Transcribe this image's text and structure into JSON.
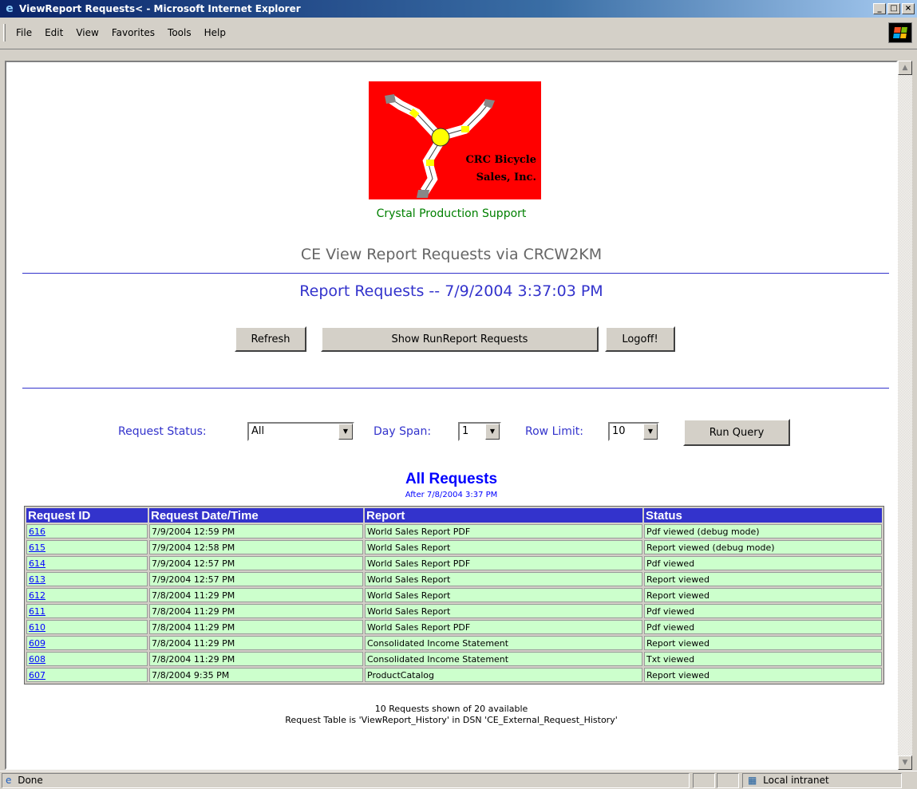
{
  "window": {
    "title": "ViewReport Requests< - Microsoft Internet Explorer",
    "minimize": "_",
    "maximize": "□",
    "close": "×"
  },
  "menu": {
    "items": [
      {
        "label": "File"
      },
      {
        "label": "Edit"
      },
      {
        "label": "View"
      },
      {
        "label": "Favorites"
      },
      {
        "label": "Tools"
      },
      {
        "label": "Help"
      }
    ]
  },
  "page": {
    "logo_line1": "CRC Bicycle",
    "logo_line2": "Sales, Inc.",
    "subtitle": "Crystal Production Support",
    "ce_title": "CE View Report Requests via CRCW2KM",
    "requests_title": "Report Requests -- 7/9/2004 3:37:03 PM",
    "buttons": {
      "refresh": "Refresh",
      "show_run": "Show RunReport Requests",
      "logoff": "Logoff!",
      "run_query": "Run Query"
    },
    "filters": {
      "status_label": "Request Status:",
      "status_value": "All",
      "dayspan_label": "Day Span:",
      "dayspan_value": "1",
      "rowlimit_label": "Row Limit:",
      "rowlimit_value": "10"
    },
    "all_title": "All Requests",
    "after_text": "After 7/8/2004 3:37 PM",
    "table": {
      "headers": [
        "Request ID",
        "Request Date/Time",
        "Report",
        "Status"
      ],
      "rows": [
        {
          "id": "616",
          "datetime": "7/9/2004 12:59 PM",
          "report": "World Sales Report PDF",
          "status": "Pdf viewed (debug mode)"
        },
        {
          "id": "615",
          "datetime": "7/9/2004 12:58 PM",
          "report": "World Sales Report",
          "status": "Report viewed (debug mode)"
        },
        {
          "id": "614",
          "datetime": "7/9/2004 12:57 PM",
          "report": "World Sales Report PDF",
          "status": "Pdf viewed"
        },
        {
          "id": "613",
          "datetime": "7/9/2004 12:57 PM",
          "report": "World Sales Report",
          "status": "Report viewed"
        },
        {
          "id": "612",
          "datetime": "7/8/2004 11:29 PM",
          "report": "World Sales Report",
          "status": "Report viewed"
        },
        {
          "id": "611",
          "datetime": "7/8/2004 11:29 PM",
          "report": "World Sales Report",
          "status": "Pdf viewed"
        },
        {
          "id": "610",
          "datetime": "7/8/2004 11:29 PM",
          "report": "World Sales Report PDF",
          "status": "Pdf viewed"
        },
        {
          "id": "609",
          "datetime": "7/8/2004 11:29 PM",
          "report": "Consolidated Income Statement",
          "status": "Report viewed"
        },
        {
          "id": "608",
          "datetime": "7/8/2004 11:29 PM",
          "report": "Consolidated Income Statement",
          "status": "Txt viewed"
        },
        {
          "id": "607",
          "datetime": "7/8/2004 9:35 PM",
          "report": "ProductCatalog",
          "status": "Report viewed"
        }
      ]
    },
    "footer_count": "10 Requests shown of 20 available",
    "footer_table": "Request Table is 'ViewReport_History' in DSN 'CE_External_Request_History'"
  },
  "statusbar": {
    "done": "Done",
    "zone": "Local intranet"
  },
  "colors": {
    "header_bg": "#3333cc",
    "row_bg": "#ccffcc",
    "logo_bg": "#ff0000",
    "subtitle": "#008000"
  }
}
